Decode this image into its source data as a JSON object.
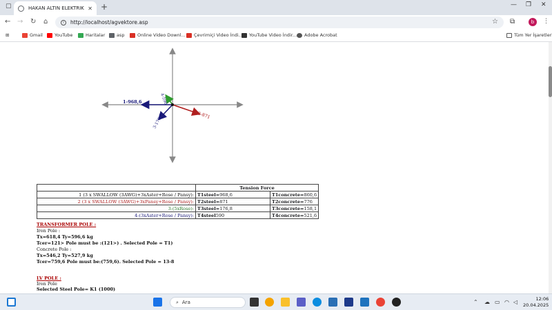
{
  "browser": {
    "tab_title": "HAKAN ALTIN ELEKTRIK ve ELE",
    "url": "http://localhost/agvektore.asp",
    "profile_initial": "b"
  },
  "bookmarks": [
    "Gmail",
    "YouTube",
    "Haritalar",
    "asp",
    "Online Video Downl...",
    "Çevrimiçi Video İndi...",
    "YouTube Video İndir...",
    "Adobe Acrobat"
  ],
  "bookmarks_folder": "Tüm Yer İşaretleri",
  "diagram": {
    "labels": {
      "left": "1-968,6",
      "up": "4-590",
      "down": "3-176,8",
      "right": "2-871"
    },
    "colors": {
      "left": "#1a1a7a",
      "up": "#2e9c2e",
      "down": "#1a1a7a",
      "right": "#b02020",
      "axes": "#888888"
    }
  },
  "tension_table": {
    "header": "Tension Force",
    "rows": [
      {
        "name": "1 (3 x SWALLOW (3AWG)+3xAster+Rose / Pansy):",
        "steel_label": "T1steel=",
        "steel_value": "968,6",
        "concrete_label": "T1concrete=",
        "concrete_value": "860,6",
        "color": "#111111"
      },
      {
        "name": "2 (3 x SWALLOW (3AWG)+3xPansy+Rose / Pansy):",
        "steel_label": "T2steel=",
        "steel_value": "871",
        "concrete_label": "T2concrete=",
        "concrete_value": "776",
        "color": "#b02020"
      },
      {
        "name": "3-(5xRose):",
        "steel_label": "T3steel=",
        "steel_value": "176,8",
        "concrete_label": "T3concrete=",
        "concrete_value": "158,1",
        "color": "#2e7d2e"
      },
      {
        "name": "4-(3xAster+Rose / Pansy):",
        "steel_label": "T4steel",
        "steel_value": "590",
        "concrete_label": "T4concrete=",
        "concrete_value": "521,6",
        "color": "#1a1a7a"
      }
    ]
  },
  "sections": {
    "transformer_title": "TRANSFORMER POLE :",
    "iron_pole": "Iron Pole :",
    "iron_tx": "Tx=618,4   Ty=596,6   kg",
    "iron_tcer": "Tcer=121>   Pole must be :(121>) . Selected Pole = T1)",
    "concrete_pole": "Concrete Pole :",
    "concrete_tx": "Tx=546,2   Ty=527,9   kg",
    "concrete_tcer": "Tcer=759,6   Pole must be:(759,6). Selected Pole = 13-8",
    "lv_title": "LV POLE :",
    "lv_iron": "Iron Pole",
    "lv_selected": "Selected  Steel Pole= K1 (1000)"
  },
  "taskbar": {
    "search_placeholder": "Ara",
    "time": "12:06",
    "date": "20.04.2025"
  }
}
